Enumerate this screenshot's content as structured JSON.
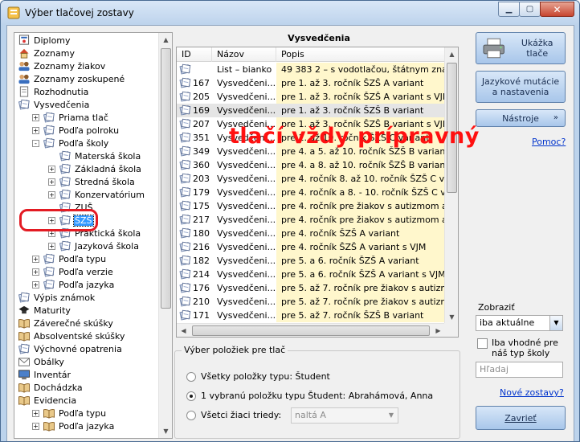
{
  "window": {
    "title": "Výber tlačovej zostavy"
  },
  "tree": {
    "items": [
      {
        "label": "Diplomy",
        "level": 0,
        "expander": "",
        "icon": "certificate-icon",
        "selected": false
      },
      {
        "label": "Zoznamy",
        "level": 0,
        "expander": "",
        "icon": "house-icon",
        "selected": false
      },
      {
        "label": "Zoznamy žiakov",
        "level": 0,
        "expander": "",
        "icon": "students-icon",
        "selected": false
      },
      {
        "label": "Zoznamy zoskupené",
        "level": 0,
        "expander": "",
        "icon": "students-icon",
        "selected": false
      },
      {
        "label": "Rozhodnutia",
        "level": 0,
        "expander": "",
        "icon": "document-icon",
        "selected": false
      },
      {
        "label": "Vysvedčenia",
        "level": 0,
        "expander": "",
        "icon": "report-card-icon",
        "selected": false
      },
      {
        "label": "Priama tlač",
        "level": 1,
        "expander": "+",
        "icon": "report-card-icon",
        "selected": false
      },
      {
        "label": "Podľa polroku",
        "level": 1,
        "expander": "+",
        "icon": "report-card-icon",
        "selected": false
      },
      {
        "label": "Podľa školy",
        "level": 1,
        "expander": "-",
        "icon": "report-card-icon",
        "selected": false
      },
      {
        "label": "Materská škola",
        "level": 2,
        "expander": "",
        "icon": "report-card-icon",
        "selected": false
      },
      {
        "label": "Základná škola",
        "level": 2,
        "expander": "+",
        "icon": "report-card-icon",
        "selected": false
      },
      {
        "label": "Stredná škola",
        "level": 2,
        "expander": "+",
        "icon": "report-card-icon",
        "selected": false
      },
      {
        "label": "Konzervatórium",
        "level": 2,
        "expander": "+",
        "icon": "report-card-icon",
        "selected": false
      },
      {
        "label": "ZUŠ",
        "level": 2,
        "expander": "",
        "icon": "report-card-icon",
        "selected": false
      },
      {
        "label": "ŠZŠ",
        "level": 2,
        "expander": "+",
        "icon": "report-card-icon",
        "selected": true
      },
      {
        "label": "Praktická škola",
        "level": 2,
        "expander": "+",
        "icon": "report-card-icon",
        "selected": false
      },
      {
        "label": "Jazyková škola",
        "level": 2,
        "expander": "+",
        "icon": "report-card-icon",
        "selected": false
      },
      {
        "label": "Podľa typu",
        "level": 1,
        "expander": "+",
        "icon": "report-card-icon",
        "selected": false
      },
      {
        "label": "Podľa verzie",
        "level": 1,
        "expander": "+",
        "icon": "report-card-icon",
        "selected": false
      },
      {
        "label": "Podľa jazyka",
        "level": 1,
        "expander": "+",
        "icon": "report-card-icon",
        "selected": false
      },
      {
        "label": "Výpis známok",
        "level": 0,
        "expander": "",
        "icon": "report-card-icon",
        "selected": false
      },
      {
        "label": "Maturity",
        "level": 0,
        "expander": "",
        "icon": "graduation-cap-icon",
        "selected": false
      },
      {
        "label": "Záverečné skúšky",
        "level": 0,
        "expander": "",
        "icon": "book-icon",
        "selected": false
      },
      {
        "label": "Absolventské skúšky",
        "level": 0,
        "expander": "",
        "icon": "book-icon",
        "selected": false
      },
      {
        "label": "Výchovné opatrenia",
        "level": 0,
        "expander": "",
        "icon": "report-card-icon",
        "selected": false
      },
      {
        "label": "Obálky",
        "level": 0,
        "expander": "",
        "icon": "envelope-icon",
        "selected": false
      },
      {
        "label": "Inventár",
        "level": 0,
        "expander": "",
        "icon": "monitor-icon",
        "selected": false
      },
      {
        "label": "Dochádzka",
        "level": 0,
        "expander": "",
        "icon": "book-icon",
        "selected": false
      },
      {
        "label": "Evidencia",
        "level": 0,
        "expander": "",
        "icon": "book-icon",
        "selected": false
      },
      {
        "label": "Podľa typu",
        "level": 1,
        "expander": "+",
        "icon": "book-icon",
        "selected": false
      },
      {
        "label": "Podľa jazyka",
        "level": 1,
        "expander": "+",
        "icon": "book-icon",
        "selected": false
      }
    ]
  },
  "list": {
    "title": "Vysvedčenia",
    "columns": [
      "ID",
      "Názov",
      "Popis"
    ],
    "rows": [
      {
        "id": "",
        "name": "List – bianko",
        "desc": "49 383 2 – s vodotlačou, štátnym znakom, ...",
        "selected": false
      },
      {
        "id": "167",
        "name": "Vysvedčeni...",
        "desc": "pre 1. až 3. ročník ŠZŠ A variant",
        "selected": false
      },
      {
        "id": "205",
        "name": "Vysvedčeni...",
        "desc": "pre 1. až 3. ročník ŠZŠ A variant s VJM",
        "selected": false
      },
      {
        "id": "169",
        "name": "Vysvedčeni...",
        "desc": "pre 1. až 3. ročník ŠZŠ B variant",
        "selected": true
      },
      {
        "id": "207",
        "name": "Vysvedčeni...",
        "desc": "pre 1. až 3. ročník ŠZŠ B variant s VJM",
        "selected": false
      },
      {
        "id": "351",
        "name": "Vysvedčeni...",
        "desc": "pre 1. až 10. ročník ŠZŠ C variant",
        "selected": false
      },
      {
        "id": "349",
        "name": "Vysvedčeni...",
        "desc": "pre 4. a 5. až 10. ročník ŠZŠ B variant",
        "selected": false
      },
      {
        "id": "360",
        "name": "Vysvedčeni...",
        "desc": "pre 4. a 8. až 10. ročník ŠZŠ B variant s V...",
        "selected": false
      },
      {
        "id": "203",
        "name": "Vysvedčeni...",
        "desc": "pre 4. ročník 8. až 10. ročník ŠZŠ C varia...",
        "selected": false
      },
      {
        "id": "179",
        "name": "Vysvedčeni...",
        "desc": "pre 4. ročník a 8. - 10. ročník ŠZŠ C variant",
        "selected": false
      },
      {
        "id": "175",
        "name": "Vysvedčeni...",
        "desc": "pre 4. ročník pre žiakov s autizmom alebo ...",
        "selected": false
      },
      {
        "id": "217",
        "name": "Vysvedčeni...",
        "desc": "pre 4. ročník pre žiakov s autizmom alebo ...",
        "selected": false
      },
      {
        "id": "180",
        "name": "Vysvedčeni...",
        "desc": "pre 4. ročník ŠZŠ A variant",
        "selected": false
      },
      {
        "id": "216",
        "name": "Vysvedčeni...",
        "desc": "pre 4. ročník ŠZŠ A variant s VJM",
        "selected": false
      },
      {
        "id": "182",
        "name": "Vysvedčeni...",
        "desc": "pre 5. a 6. ročník ŠZŠ A variant",
        "selected": false
      },
      {
        "id": "214",
        "name": "Vysvedčeni...",
        "desc": "pre 5. a 6. ročník ŠZŠ A variant s VJM",
        "selected": false
      },
      {
        "id": "176",
        "name": "Vysvedčeni...",
        "desc": "pre 5. až 7. ročník pre žiakov s autizmom a...",
        "selected": false
      },
      {
        "id": "210",
        "name": "Vysvedčeni...",
        "desc": "pre 5. až 7. ročník pre žiakov s autizmom a...",
        "selected": false
      },
      {
        "id": "171",
        "name": "Vysvedčeni...",
        "desc": "pre 5. až 7. ročník ŠZŠ B variant",
        "selected": false
      }
    ]
  },
  "overlay_note": "tlačí vždy prípravný",
  "selection": {
    "title": "Výber položiek pre tlač",
    "option_all": "Všetky položky typu: Študent",
    "option_one": "1 vybranú položku typu Študent: Abrahámová, Anna",
    "option_class": "Všetci žiaci triedy:",
    "class_value": "naltá A",
    "selected_option": "one"
  },
  "right": {
    "preview_button": "Ukážka tlače",
    "language_button_line1": "Jazykové mutácie",
    "language_button_line2": "a nastavenia",
    "tools_button": "Nástroje",
    "help_link": "Pomoc?",
    "show_label": "Zobraziť",
    "show_value": "iba aktuálne",
    "filter_label_line1": "Iba vhodné pre",
    "filter_label_line2": "náš typ školy",
    "search_placeholder": "Hľadaj",
    "new_reports_link": "Nové zostavy?",
    "close_button": "Zavrieť"
  }
}
